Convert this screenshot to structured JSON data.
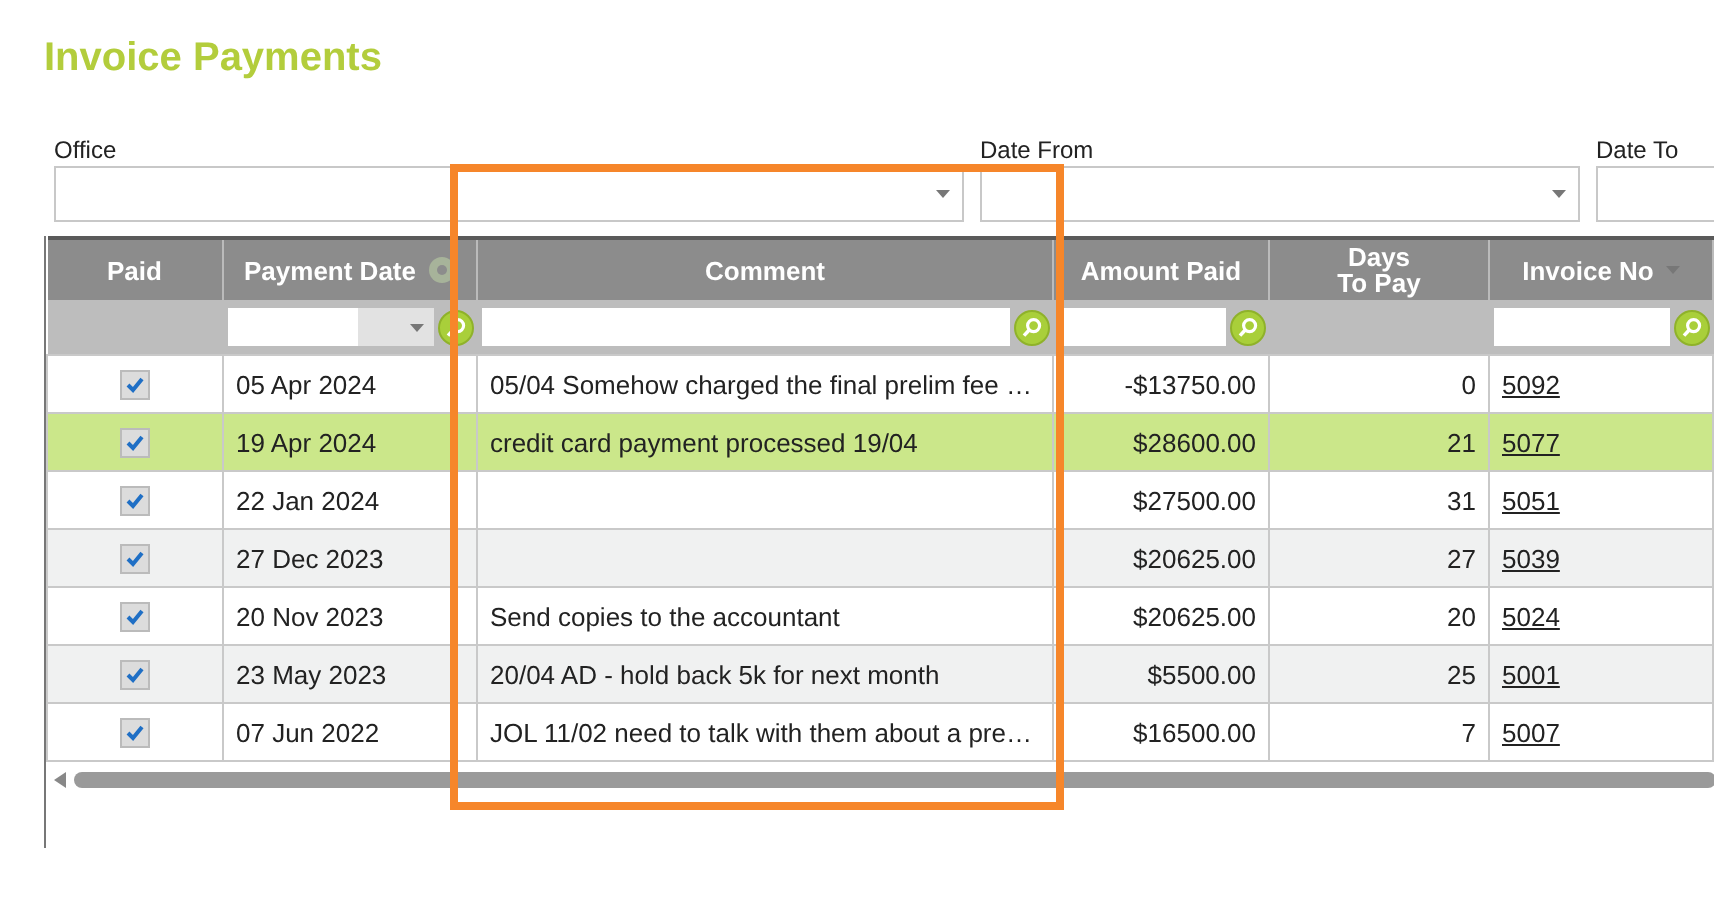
{
  "title": "Invoice Payments",
  "filters": [
    {
      "label": "Office",
      "kind": "dropdown"
    },
    {
      "label": "Date From",
      "kind": "dropdown"
    },
    {
      "label": "Date To",
      "kind": "text"
    }
  ],
  "table": {
    "columns": [
      {
        "label": "Paid",
        "kind": "checkbox"
      },
      {
        "label": "Payment Date",
        "kind": "date"
      },
      {
        "label": "Comment",
        "kind": "text"
      },
      {
        "label": "Amount Paid",
        "kind": "amount"
      },
      {
        "label": "Days To Pay",
        "kind": "number"
      },
      {
        "label": "Invoice No",
        "kind": "link"
      }
    ],
    "rows": [
      {
        "paid": true,
        "payment_date": "05 Apr 2024",
        "comment": "05/04 Somehow charged the final prelim fee …",
        "amount_paid": "-$13750.00",
        "days_to_pay": "0",
        "invoice_no": "5092",
        "selected": false
      },
      {
        "paid": true,
        "payment_date": "19 Apr 2024",
        "comment": "credit card payment processed 19/04",
        "amount_paid": "$28600.00",
        "days_to_pay": "21",
        "invoice_no": "5077",
        "selected": true
      },
      {
        "paid": true,
        "payment_date": "22 Jan 2024",
        "comment": "",
        "amount_paid": "$27500.00",
        "days_to_pay": "31",
        "invoice_no": "5051",
        "selected": false
      },
      {
        "paid": true,
        "payment_date": "27 Dec 2023",
        "comment": "",
        "amount_paid": "$20625.00",
        "days_to_pay": "27",
        "invoice_no": "5039",
        "selected": false
      },
      {
        "paid": true,
        "payment_date": "20 Nov 2023",
        "comment": "Send copies to the accountant",
        "amount_paid": "$20625.00",
        "days_to_pay": "20",
        "invoice_no": "5024",
        "selected": false
      },
      {
        "paid": true,
        "payment_date": "23 May 2023",
        "comment": "20/04 AD - hold back 5k for next month",
        "amount_paid": "$5500.00",
        "days_to_pay": "25",
        "invoice_no": "5001",
        "selected": false
      },
      {
        "paid": true,
        "payment_date": "07 Jun 2022",
        "comment": "JOL 11/02 need to talk with them about a pre…",
        "amount_paid": "$16500.00",
        "days_to_pay": "7",
        "invoice_no": "5007",
        "selected": false
      }
    ]
  }
}
